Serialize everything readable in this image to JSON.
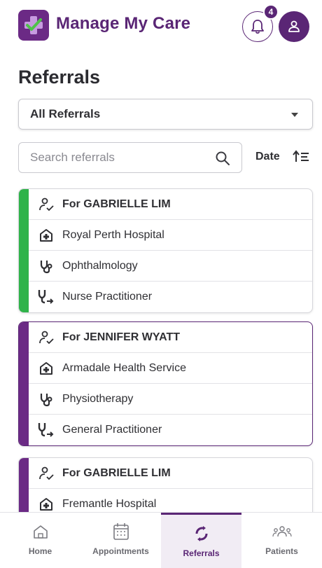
{
  "app": {
    "title": "Manage My Care"
  },
  "notifications": {
    "count": "4"
  },
  "page": {
    "title": "Referrals"
  },
  "filter": {
    "selected": "All Referrals"
  },
  "search": {
    "placeholder": "Search referrals",
    "value": ""
  },
  "sort": {
    "label": "Date"
  },
  "colors": {
    "brand": "#5a2675",
    "accent_green": "#2fb34a",
    "accent_purple": "#6b2a85"
  },
  "referrals": [
    {
      "patient": "For GABRIELLE LIM",
      "facility": "Royal Perth Hospital",
      "specialty": "Ophthalmology",
      "referrer": "Nurse Practitioner"
    },
    {
      "patient": "For JENNIFER WYATT",
      "facility": "Armadale Health Service",
      "specialty": "Physiotherapy",
      "referrer": "General Practitioner"
    },
    {
      "patient": "For GABRIELLE LIM",
      "facility": "Fremantle Hospital"
    }
  ],
  "nav": [
    {
      "label": "Home",
      "icon": "home-icon"
    },
    {
      "label": "Appointments",
      "icon": "calendar-icon"
    },
    {
      "label": "Referrals",
      "icon": "referral-icon"
    },
    {
      "label": "Patients",
      "icon": "patients-icon"
    }
  ]
}
